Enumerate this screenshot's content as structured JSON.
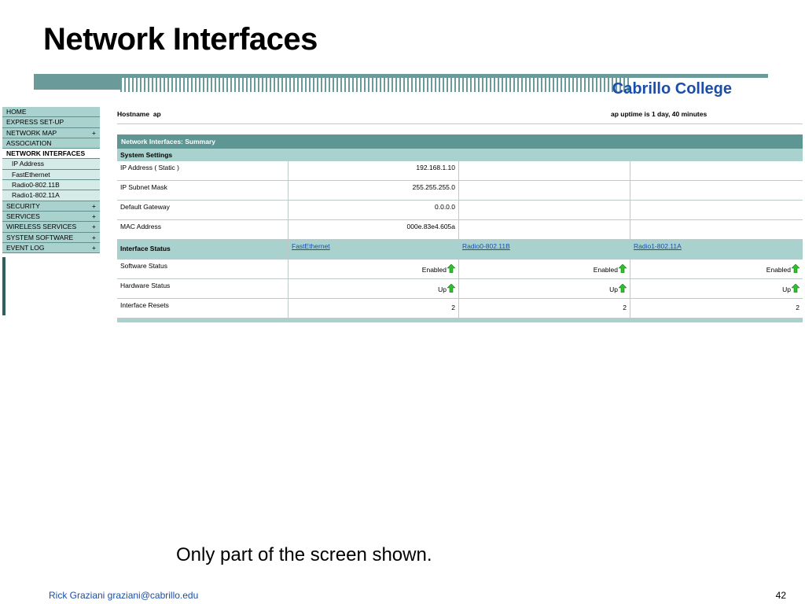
{
  "slide": {
    "title": "Network Interfaces",
    "caption": "Only part of the screen shown.",
    "footer": "Rick Graziani  graziani@cabrillo.edu",
    "page_number": "42"
  },
  "banner": {
    "brand": "Cabrillo College"
  },
  "sidebar": {
    "items": [
      {
        "label": "HOME",
        "plus": ""
      },
      {
        "label": "EXPRESS SET-UP",
        "plus": ""
      },
      {
        "label": "NETWORK MAP",
        "plus": "+"
      },
      {
        "label": "ASSOCIATION",
        "plus": ""
      },
      {
        "label": "NETWORK INTERFACES",
        "plus": ""
      },
      {
        "label": "IP Address",
        "plus": ""
      },
      {
        "label": "FastEthernet",
        "plus": ""
      },
      {
        "label": "Radio0-802.11B",
        "plus": ""
      },
      {
        "label": "Radio1-802.11A",
        "plus": ""
      },
      {
        "label": "SECURITY",
        "plus": "+"
      },
      {
        "label": "SERVICES",
        "plus": "+"
      },
      {
        "label": "WIRELESS SERVICES",
        "plus": "+"
      },
      {
        "label": "SYSTEM SOFTWARE",
        "plus": "+"
      },
      {
        "label": "EVENT LOG",
        "plus": "+"
      }
    ]
  },
  "header": {
    "hostname_label": "Hostname",
    "hostname": "ap",
    "uptime": "ap uptime is 1 day, 40 minutes"
  },
  "panel": {
    "title": "Network Interfaces: Summary",
    "system_settings_label": "System Settings",
    "system_rows": [
      {
        "label": "IP Address ( Static )",
        "value": "192.168.1.10"
      },
      {
        "label": "IP Subnet Mask",
        "value": "255.255.255.0"
      },
      {
        "label": "Default Gateway",
        "value": "0.0.0.0"
      },
      {
        "label": "MAC Address",
        "value": "000e.83e4.605a"
      }
    ],
    "interface_status_label": "Interface Status",
    "interfaces": [
      "FastEthernet",
      "Radio0-802.11B",
      "Radio1-802.11A"
    ],
    "status_rows": [
      {
        "label": "Software Status",
        "values": [
          "Enabled",
          "Enabled",
          "Enabled"
        ],
        "arrow": true
      },
      {
        "label": "Hardware Status",
        "values": [
          "Up",
          "Up",
          "Up"
        ],
        "arrow": true
      },
      {
        "label": "Interface Resets",
        "values": [
          "2",
          "2",
          "2"
        ],
        "arrow": false
      }
    ],
    "arrow_icon": "green-up-arrow-icon",
    "arrow_color": "#2fbf2f"
  }
}
